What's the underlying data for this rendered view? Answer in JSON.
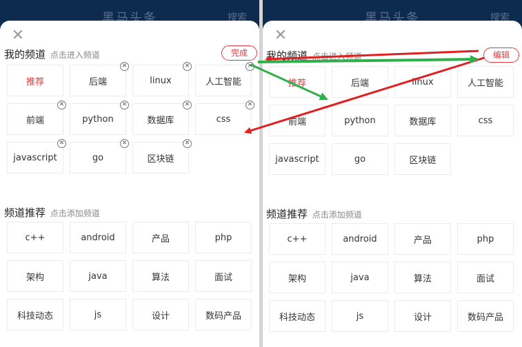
{
  "header": {
    "title": "黑马头条",
    "search": "搜索"
  },
  "left": {
    "my_channels": {
      "title": "我的频道",
      "hint": "点击进入频道",
      "mode_button": "完成",
      "items": [
        {
          "label": "推荐",
          "active": true
        },
        {
          "label": "后端"
        },
        {
          "label": "linux"
        },
        {
          "label": "人工智能"
        },
        {
          "label": "前端"
        },
        {
          "label": "python"
        },
        {
          "label": "数据库"
        },
        {
          "label": "css"
        },
        {
          "label": "javascript"
        },
        {
          "label": "go"
        },
        {
          "label": "区块链"
        }
      ]
    },
    "recommend": {
      "title": "频道推荐",
      "hint": "点击添加频道",
      "items": [
        "c++",
        "android",
        "产品",
        "php",
        "架构",
        "java",
        "算法",
        "面试",
        "科技动态",
        "js",
        "设计",
        "数码产品"
      ]
    }
  },
  "right": {
    "my_channels": {
      "title": "我的频道",
      "hint": "点击进入频道",
      "mode_button": "编辑",
      "items": [
        {
          "label": "推荐",
          "active": true
        },
        {
          "label": "后端"
        },
        {
          "label": "linux"
        },
        {
          "label": "人工智能"
        },
        {
          "label": "前端"
        },
        {
          "label": "python"
        },
        {
          "label": "数据库"
        },
        {
          "label": "css"
        },
        {
          "label": "javascript"
        },
        {
          "label": "go"
        },
        {
          "label": "区块链"
        }
      ]
    },
    "recommend": {
      "title": "频道推荐",
      "hint": "点击添加频道",
      "items": [
        "c++",
        "android",
        "产品",
        "php",
        "架构",
        "java",
        "算法",
        "面试",
        "科技动态",
        "js",
        "设计",
        "数码产品"
      ]
    }
  },
  "colors": {
    "accent": "#e23b3b",
    "arrow_red": "#e02020",
    "arrow_green": "#2fae4a",
    "header_bg": "#0d2a4f"
  },
  "icons": {
    "close": "close-icon",
    "remove": "remove-circle-icon"
  }
}
